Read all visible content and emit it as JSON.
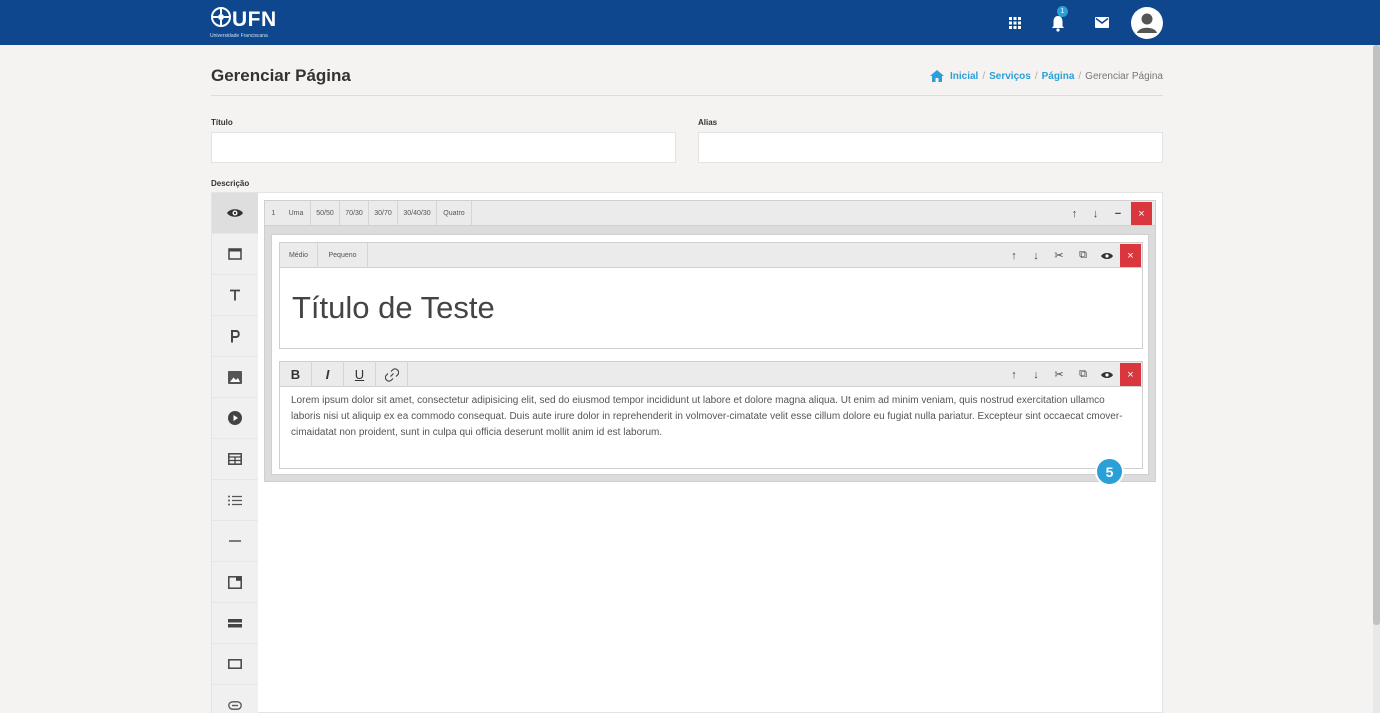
{
  "header": {
    "logo_text": "UFN",
    "logo_subtitle": "Universidade Franciscana",
    "notification_count": "1",
    "icons": [
      "apps-grid-icon",
      "bell-icon",
      "mail-icon",
      "user-avatar-icon"
    ],
    "bar_color": "#0e478d"
  },
  "page": {
    "title": "Gerenciar Página",
    "breadcrumb": [
      {
        "label": "Inicial",
        "link": true
      },
      {
        "label": "Serviços",
        "link": true
      },
      {
        "label": "Página",
        "link": true
      },
      {
        "label": "Gerenciar Página",
        "link": false
      }
    ],
    "accent_color": "#2a9fd8"
  },
  "form": {
    "titulo_label": "Título",
    "titulo_value": "",
    "alias_label": "Alias",
    "alias_value": "",
    "descricao_label": "Descrição"
  },
  "toolbox": {
    "tools": [
      "eye-icon",
      "section-icon",
      "text-heading-icon",
      "paragraph-icon",
      "image-icon",
      "video-icon",
      "table-icon",
      "list-icon",
      "divider-icon",
      "card-icon",
      "banner-icon",
      "box-icon",
      "link-icon"
    ]
  },
  "row": {
    "index": "1",
    "layout_options": [
      "Uma",
      "50/50",
      "70/30",
      "30/70",
      "30/40/30",
      "Quatro"
    ],
    "controls": [
      "↑",
      "↓",
      "−",
      "×"
    ]
  },
  "heading_widget": {
    "size_options": [
      "Médio",
      "Pequeno"
    ],
    "controls": [
      "↑",
      "↓",
      "✂",
      "⧉",
      "👁",
      "×"
    ],
    "text": "Título de Teste"
  },
  "text_widget": {
    "format_buttons": [
      "B",
      "I",
      "U",
      "🔗"
    ],
    "controls": [
      "↑",
      "↓",
      "✂",
      "⧉",
      "👁",
      "×"
    ],
    "text": "Lorem ipsum dolor sit amet, consectetur adipisicing elit, sed do eiusmod tempor incididunt ut labore et dolore magna aliqua. Ut enim ad minim veniam, quis nostrud exercitation ullamco laboris nisi ut aliquip ex ea commodo consequat. Duis aute irure dolor in reprehenderit in volmover-cimatate velit esse cillum dolore eu fugiat nulla pariatur. Excepteur sint occaecat cmover-cimaidatat non proident, sunt in culpa qui officia deserunt mollit anim id est laborum."
  },
  "step_badge": "5",
  "delete_color": "#d9363e"
}
